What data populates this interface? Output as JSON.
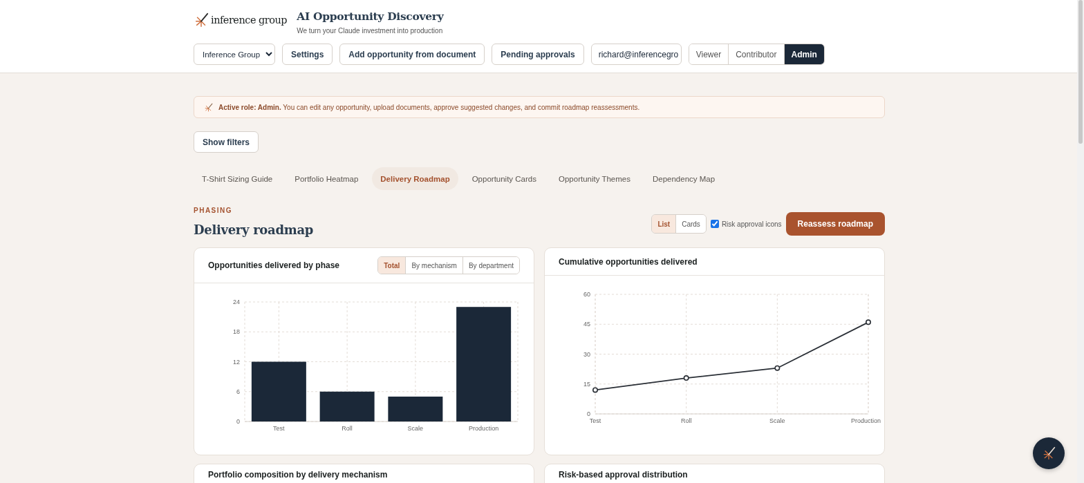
{
  "brand": {
    "name": "inference group"
  },
  "app": {
    "title": "AI Opportunity Discovery",
    "subtitle": "We turn your Claude investment into production"
  },
  "toolbar": {
    "organization_select": "Inference Group",
    "buttons": [
      "Settings",
      "Add opportunity from document",
      "Pending approvals"
    ],
    "user_field": "richard@inferencegro",
    "roles": [
      {
        "label": "Viewer",
        "selected": false
      },
      {
        "label": "Contributor",
        "selected": false
      },
      {
        "label": "Admin",
        "selected": true
      }
    ]
  },
  "banner": {
    "text": "**Active role: Admin.** You can edit any opportunity, upload documents, approve suggested changes, and commit roadmap reassessments."
  },
  "filters_button": "Show filters",
  "tabs": [
    {
      "label": "T-Shirt Sizing Guide",
      "selected": false
    },
    {
      "label": "Portfolio Heatmap",
      "selected": false
    },
    {
      "label": "Delivery Roadmap",
      "selected": true
    },
    {
      "label": "Opportunity Cards",
      "selected": false
    },
    {
      "label": "Opportunity Themes",
      "selected": false
    },
    {
      "label": "Dependency Map",
      "selected": false
    }
  ],
  "section": {
    "eyebrow": "PHASING",
    "title": "Delivery roadmap",
    "view_toggle": [
      {
        "label": "List",
        "selected": true
      },
      {
        "label": "Cards",
        "selected": false
      }
    ],
    "risk_icons": {
      "label": "Risk approval icons",
      "checked": true
    },
    "action": "Reassess roadmap"
  },
  "charts": [
    {
      "title": "Opportunities delivered by phase",
      "segments": [
        {
          "label": "Total",
          "selected": true
        },
        {
          "label": "By mechanism",
          "selected": false
        },
        {
          "label": "By department",
          "selected": false
        }
      ],
      "chart_data": {
        "type": "bar",
        "categories": [
          "Test",
          "Roll",
          "Scale",
          "Production"
        ],
        "series": [
          {
            "color": "#1b2838",
            "values": [
              12,
              6,
              5,
              23
            ]
          }
        ],
        "grid": true,
        "ylim": [
          0,
          24
        ],
        "yticks": [
          0,
          6,
          12,
          18,
          24
        ]
      }
    },
    {
      "title": "Cumulative opportunities delivered",
      "chart_data": {
        "type": "line",
        "categories": [
          "Test",
          "Roll",
          "Scale",
          "Production"
        ],
        "series": [
          {
            "color": "#2a2f36",
            "marker": true,
            "values": [
              12,
              18,
              23,
              46
            ]
          }
        ],
        "grid": true,
        "ylim": [
          0,
          60
        ],
        "yticks": [
          0,
          15,
          30,
          45,
          60
        ]
      }
    }
  ],
  "lower_cards": [
    {
      "title": "Portfolio composition by delivery mechanism"
    },
    {
      "title": "Risk-based approval distribution"
    }
  ]
}
